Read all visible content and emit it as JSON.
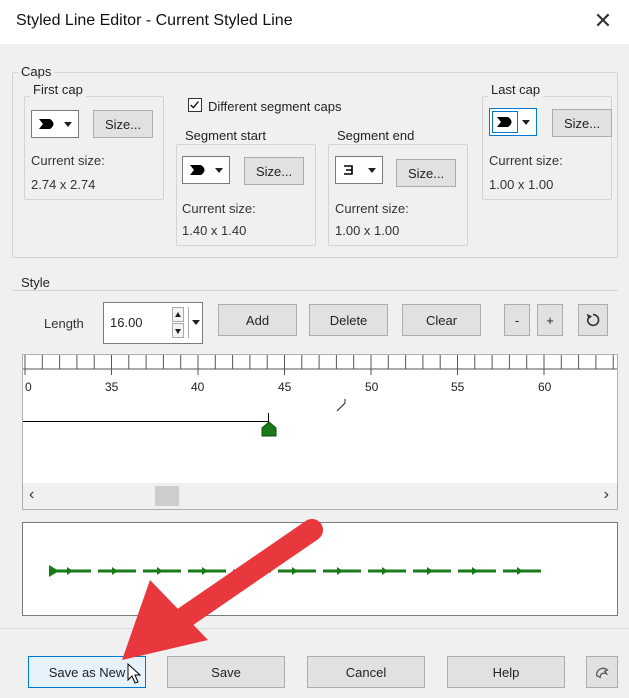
{
  "window": {
    "title": "Styled Line Editor -  Current Styled Line"
  },
  "caps": {
    "label": "Caps",
    "first_cap": {
      "label": "First cap",
      "size_button": "Size...",
      "current_size_label": "Current size:",
      "current_size_value": "2.74 x 2.74"
    },
    "different_segment_caps": {
      "label": "Different segment caps",
      "checked": true
    },
    "segment_start": {
      "label": "Segment start",
      "size_button": "Size...",
      "current_size_label": "Current size:",
      "current_size_value": "1.40 x 1.40"
    },
    "segment_end": {
      "label": "Segment end",
      "size_button": "Size...",
      "current_size_label": "Current size:",
      "current_size_value": "1.00 x 1.00"
    },
    "last_cap": {
      "label": "Last cap",
      "size_button": "Size...",
      "current_size_label": "Current size:",
      "current_size_value": "1.00 x 1.00"
    }
  },
  "style": {
    "label": "Style",
    "length_label": "Length",
    "length_value": "16.00",
    "add_button": "Add",
    "delete_button": "Delete",
    "clear_button": "Clear",
    "minus_button": "-",
    "plus_button": "+",
    "ruler_labels": [
      "0",
      "35",
      "40",
      "45",
      "50",
      "55",
      "60"
    ]
  },
  "footer": {
    "save_as_new": "Save as New",
    "save": "Save",
    "cancel": "Cancel",
    "help": "Help"
  },
  "colors": {
    "accent_green": "#1a7a1a",
    "annotation_red": "#e8383d"
  }
}
